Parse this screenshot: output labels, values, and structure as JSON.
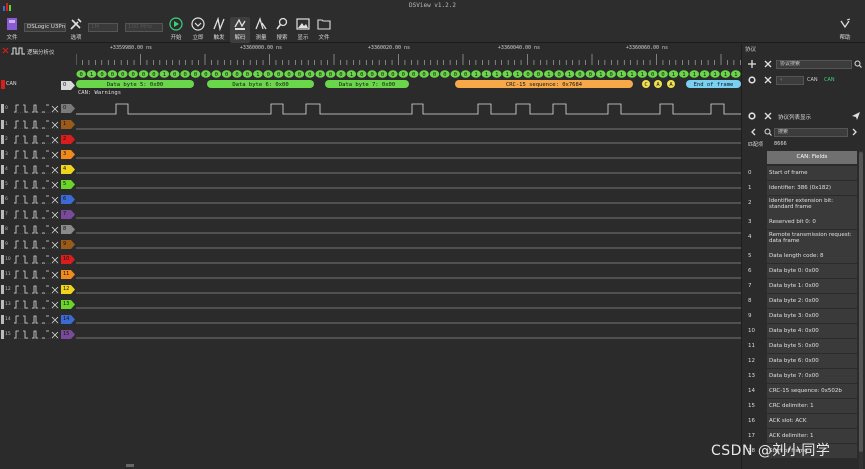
{
  "window": {
    "title": "DSView v1.2.2"
  },
  "toolbar": {
    "file_label": "文件",
    "device_name": "DSLogic U3Pro16",
    "options_label": "选项",
    "sample_count": "1M",
    "sample_rate": "100 MHz",
    "start_label": "开始",
    "instant_label": "立即",
    "trigger_label": "触发",
    "decode_label": "解码",
    "measure_label": "测量",
    "search_label": "搜索",
    "display_label": "显示",
    "file2_label": "文件",
    "help_label": "帮助"
  },
  "analyzer_tab": {
    "label": "逻辑分析仪"
  },
  "ruler": {
    "labels": [
      "+3359980.00 ns",
      "+3360000.00 ns",
      "+3360020.00 ns",
      "+3360040.00 ns",
      "+3360060.00 ns"
    ]
  },
  "can_channel": {
    "label": "CAN",
    "tag": "0",
    "warning": "CAN: Warnings",
    "bits": [
      "0",
      "1",
      "0",
      "0",
      "0",
      "0",
      "0",
      "0",
      "1",
      "0",
      "0",
      "0",
      "0",
      "0",
      "0",
      "0",
      "0",
      "1",
      "0",
      "0",
      "0",
      "0",
      "0",
      "0",
      "0",
      "0",
      "1",
      "0",
      "0",
      "0",
      "0",
      "0",
      "0",
      "0",
      "0",
      "0",
      "0",
      "0",
      "1",
      "1",
      "1",
      "1",
      "1",
      "0",
      "0",
      "1",
      "0",
      "1",
      "0",
      "0",
      "1",
      "0",
      "1",
      "1",
      "1",
      "0",
      "0",
      "1",
      "1",
      "1",
      "1",
      "1",
      "1",
      "1"
    ],
    "segments": [
      {
        "text": "Data byte 5: 0x00",
        "color": "#6ad64a"
      },
      {
        "text": "Data byte 6: 0x00",
        "color": "#6ad64a"
      },
      {
        "text": "Data byte 7: 0x00",
        "color": "#6ad64a"
      },
      {
        "text": "CRC-15 sequence: 0x7684",
        "color": "#f7a94a"
      },
      {
        "text": "C",
        "color": "#f0e050"
      },
      {
        "text": "A",
        "color": "#f0e050"
      },
      {
        "text": "A",
        "color": "#f0e050"
      },
      {
        "text": "End of frame",
        "color": "#7ad0f0"
      }
    ]
  },
  "channels": [
    {
      "num": "0",
      "tag": "0",
      "color": "#7a7a7a"
    },
    {
      "num": "1",
      "tag": "1",
      "color": "#9a5a1a"
    },
    {
      "num": "2",
      "tag": "2",
      "color": "#d91c1c"
    },
    {
      "num": "3",
      "tag": "3",
      "color": "#f08a1c"
    },
    {
      "num": "4",
      "tag": "4",
      "color": "#f0d41c"
    },
    {
      "num": "5",
      "tag": "5",
      "color": "#6ad42a"
    },
    {
      "num": "6",
      "tag": "6",
      "color": "#3a6ad4"
    },
    {
      "num": "7",
      "tag": "7",
      "color": "#7a4a9a"
    },
    {
      "num": "8",
      "tag": "8",
      "color": "#8a8a8a"
    },
    {
      "num": "9",
      "tag": "9",
      "color": "#9a5a1a"
    },
    {
      "num": "10",
      "tag": "10",
      "color": "#d91c1c"
    },
    {
      "num": "11",
      "tag": "11",
      "color": "#f08a1c"
    },
    {
      "num": "12",
      "tag": "12",
      "color": "#f0d41c"
    },
    {
      "num": "13",
      "tag": "13",
      "color": "#6ad42a"
    },
    {
      "num": "14",
      "tag": "14",
      "color": "#3a6ad4"
    },
    {
      "num": "15",
      "tag": "15",
      "color": "#7a4a9a"
    }
  ],
  "right_panel": {
    "header": "协议",
    "protocol_search_placeholder": "协议搜索",
    "decoder_name": "CAN",
    "decoder_tag": "CAN",
    "list_title": "协议列表显示",
    "search_placeholder": "搜索",
    "match_label": "匹配项",
    "match_count": "8666",
    "fields_header": "CAN: Fields",
    "fields": [
      {
        "idx": "0",
        "text": "Start of frame"
      },
      {
        "idx": "1",
        "text": "Identifier: 386 (0x182)"
      },
      {
        "idx": "2",
        "text": "Identifier extension bit: standard frame"
      },
      {
        "idx": "3",
        "text": "Reserved bit 0: 0"
      },
      {
        "idx": "4",
        "text": "Remote transmission request: data frame"
      },
      {
        "idx": "5",
        "text": "Data length code: 8"
      },
      {
        "idx": "6",
        "text": "Data byte 0: 0x00"
      },
      {
        "idx": "7",
        "text": "Data byte 1: 0x00"
      },
      {
        "idx": "8",
        "text": "Data byte 2: 0x00"
      },
      {
        "idx": "9",
        "text": "Data byte 3: 0x00"
      },
      {
        "idx": "10",
        "text": "Data byte 4: 0x00"
      },
      {
        "idx": "11",
        "text": "Data byte 5: 0x00"
      },
      {
        "idx": "12",
        "text": "Data byte 6: 0x00"
      },
      {
        "idx": "13",
        "text": "Data byte 7: 0x00"
      },
      {
        "idx": "14",
        "text": "CRC-15 sequence: 0x502b"
      },
      {
        "idx": "15",
        "text": "CRC delimiter: 1"
      },
      {
        "idx": "16",
        "text": "ACK slot: ACK"
      },
      {
        "idx": "17",
        "text": "ACK delimiter: 1"
      },
      {
        "idx": "18",
        "text": "Start of frame"
      }
    ]
  },
  "watermark": "CSDN @刘小同学"
}
